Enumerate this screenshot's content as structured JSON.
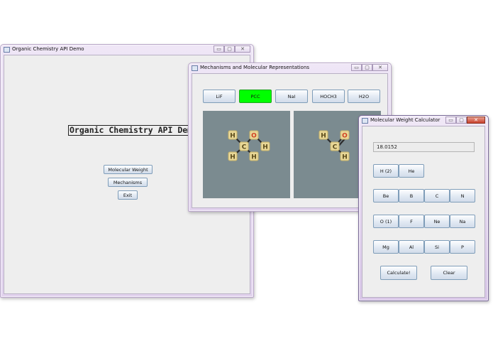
{
  "main_window": {
    "title": "Organic Chemistry API Demo",
    "heading": "Organic Chemistry API Demo",
    "buttons": {
      "molecular_weight": "Molecular Weight",
      "mechanisms": "Mechanisms",
      "exit": "Exit"
    }
  },
  "mechanisms_window": {
    "title": "Mechanisms and Molecular Representations",
    "tabs": [
      "LiF",
      "PCC",
      "NaI",
      "HOCH3",
      "H2O"
    ],
    "selected_tab": "PCC",
    "highlight_color": "#00ff00",
    "molecule_left": {
      "atoms": [
        "H",
        "O",
        "C",
        "H",
        "H",
        "H"
      ]
    },
    "molecule_right": {
      "atoms": [
        "H",
        "O",
        "C",
        "H"
      ]
    }
  },
  "calculator_window": {
    "title": "Molecular Weight Calculator",
    "result": "18.0152",
    "element_rows": [
      [
        "H (2)",
        "He"
      ],
      [
        "Be",
        "B",
        "C",
        "N"
      ],
      [
        "O (1)",
        "F",
        "Ne",
        "Na"
      ],
      [
        "Mg",
        "Al",
        "Si",
        "P"
      ]
    ],
    "actions": {
      "calculate": "Calculate!",
      "clear": "Clear"
    }
  },
  "window_controls": {
    "minimize": "▭",
    "maximize": "▢",
    "close": "✕"
  }
}
